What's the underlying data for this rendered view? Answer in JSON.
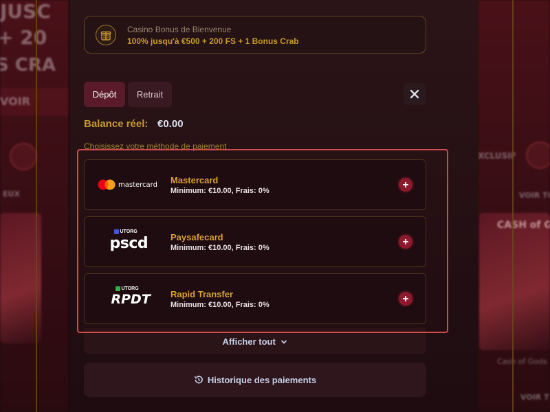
{
  "bonus": {
    "title": "Casino Bonus de Bienvenue",
    "text": "100% jusqu'à €500 + 200 FS + 1 Bonus Crab",
    "icon": "gift-box-icon"
  },
  "tabs": [
    {
      "label": "Dépôt",
      "active": true
    },
    {
      "label": "Retrait",
      "active": false
    }
  ],
  "balance": {
    "label": "Balance réel:",
    "value": "€0.00"
  },
  "choose_label": "Choisissez votre méthode de paiement",
  "methods": [
    {
      "name": "Mastercard",
      "info": "Minimum: €10.00, Frais: 0%",
      "logo_text": "mastercard"
    },
    {
      "name": "Paysafecard",
      "info": "Minimum: €10.00, Frais: 0%",
      "logo_brand": "UTORG",
      "logo_text": "pscd"
    },
    {
      "name": "Rapid Transfer",
      "info": "Minimum: €10.00, Frais: 0%",
      "logo_brand": "UTORG",
      "logo_text": "RPDT"
    }
  ],
  "show_all": "Afficher tout",
  "history": "Historique des paiements",
  "background": {
    "left_texts": [
      "JUSC",
      "+ 20",
      "S CRA",
      "VOIR",
      "EUX"
    ],
    "right_texts": [
      "XCLUSIF",
      "VOIR TO",
      "Cash of Gods",
      "VOIR T"
    ],
    "tile_text": "CASH of GODS"
  },
  "colors": {
    "accent_gold": "#c89a2c",
    "deposit_tab": "#5a1a2a",
    "plus_button": "#8a1a2c",
    "highlight_border": "#d04a4e"
  }
}
